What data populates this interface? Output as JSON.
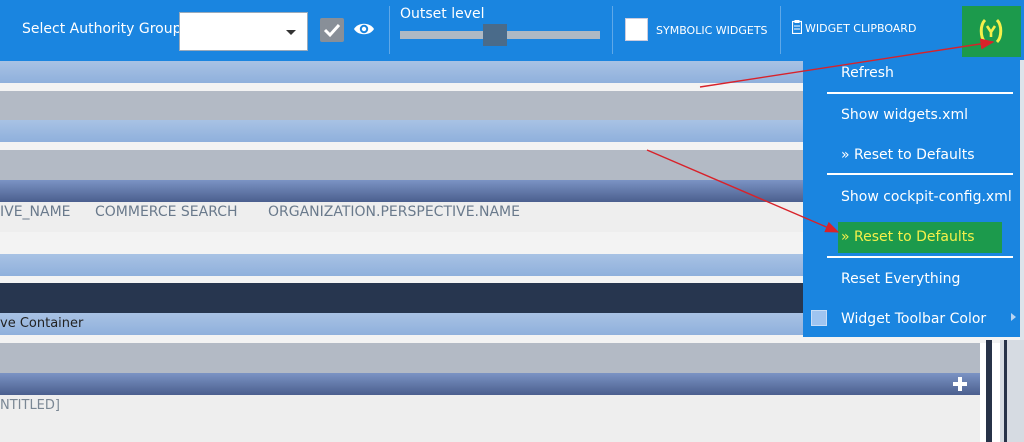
{
  "toolbar": {
    "authority_group_label": "Select Authority Group",
    "authority_group_value": "",
    "outset_level_label": "Outset level",
    "outset_level_value": 0.47,
    "symbolic_widgets_label": "SYMBOLIC WIDGETS",
    "widget_clipboard_label": "WIDGET CLIPBOARD",
    "visible_check_checked": true
  },
  "content": {
    "row_texts": [
      "IVE_NAME",
      "COMMERCE SEARCH",
      "ORGANIZATION.PERSPECTIVE.NAME"
    ],
    "perspective_container_label": "ve Container",
    "untitled_label": "NTITLED]"
  },
  "menu": {
    "items": [
      "Refresh",
      "Show widgets.xml",
      "» Reset to Defaults",
      "Show cockpit-config.xml",
      "» Reset to Defaults",
      "Reset Everything",
      "Widget Toolbar Color"
    ]
  },
  "colors": {
    "toolbar_blue": "#1a85e0",
    "highlight_green": "#1c9a4c",
    "highlight_text_yellow": "#f5f04a",
    "annotation_arrow_red": "#d8222a",
    "swatch_light_blue": "#9fc4f0"
  },
  "icons": [
    "caret-down-icon",
    "checkmark-icon",
    "eye-icon",
    "clipboard-icon",
    "hybris-logo-icon",
    "plus-icon",
    "chevron-right-icon"
  ]
}
